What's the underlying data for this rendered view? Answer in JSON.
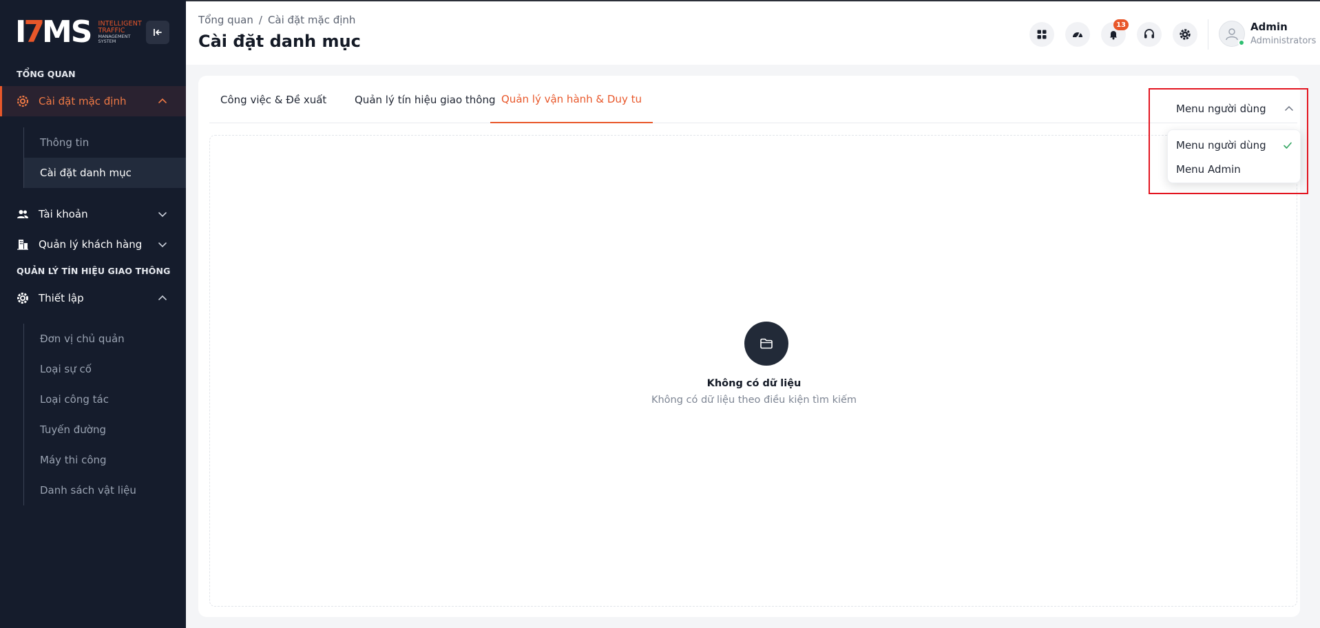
{
  "brand": {
    "logo_text": "ITMS",
    "line1": "INTELLIGENT",
    "line2": "TRAFFIC",
    "line3": "MANAGEMENT",
    "line4": "SYSTEM"
  },
  "sidebar": {
    "section_overview": "TỔNG QUAN",
    "default_settings": "Cài đặt mặc định",
    "default_sub": [
      "Thông tin",
      "Cài đặt danh mục"
    ],
    "account": "Tài khoản",
    "customers": "Quản lý khách hàng",
    "section_signal": "QUẢN LÝ TÍN HIỆU GIAO THÔNG",
    "setup": "Thiết lập",
    "setup_sub": [
      "Đơn vị chủ quản",
      "Loại sự cố",
      "Loại công tác",
      "Tuyến đường",
      "Máy thi công",
      "Danh sách vật liệu"
    ]
  },
  "header": {
    "breadcrumb_root": "Tổng quan",
    "breadcrumb_sep": "/",
    "breadcrumb_current": "Cài đặt mặc định",
    "title": "Cài đặt danh mục",
    "notification_count": "13",
    "user_name": "Admin",
    "user_role": "Administrators"
  },
  "tabs": [
    "Công việc & Đề xuất",
    "Quản lý tín hiệu giao thông",
    "Quản lý vận hành & Duy tu"
  ],
  "active_tab": 2,
  "empty": {
    "title": "Không có dữ liệu",
    "description": "Không có dữ liệu theo điều kiện tìm kiếm"
  },
  "menu_selector": {
    "selected": "Menu người dùng",
    "options": [
      "Menu người dùng",
      "Menu Admin"
    ]
  },
  "colors": {
    "accent": "#e8572a",
    "sidebar_bg": "#151c2c",
    "highlight_border": "#e3141f"
  }
}
